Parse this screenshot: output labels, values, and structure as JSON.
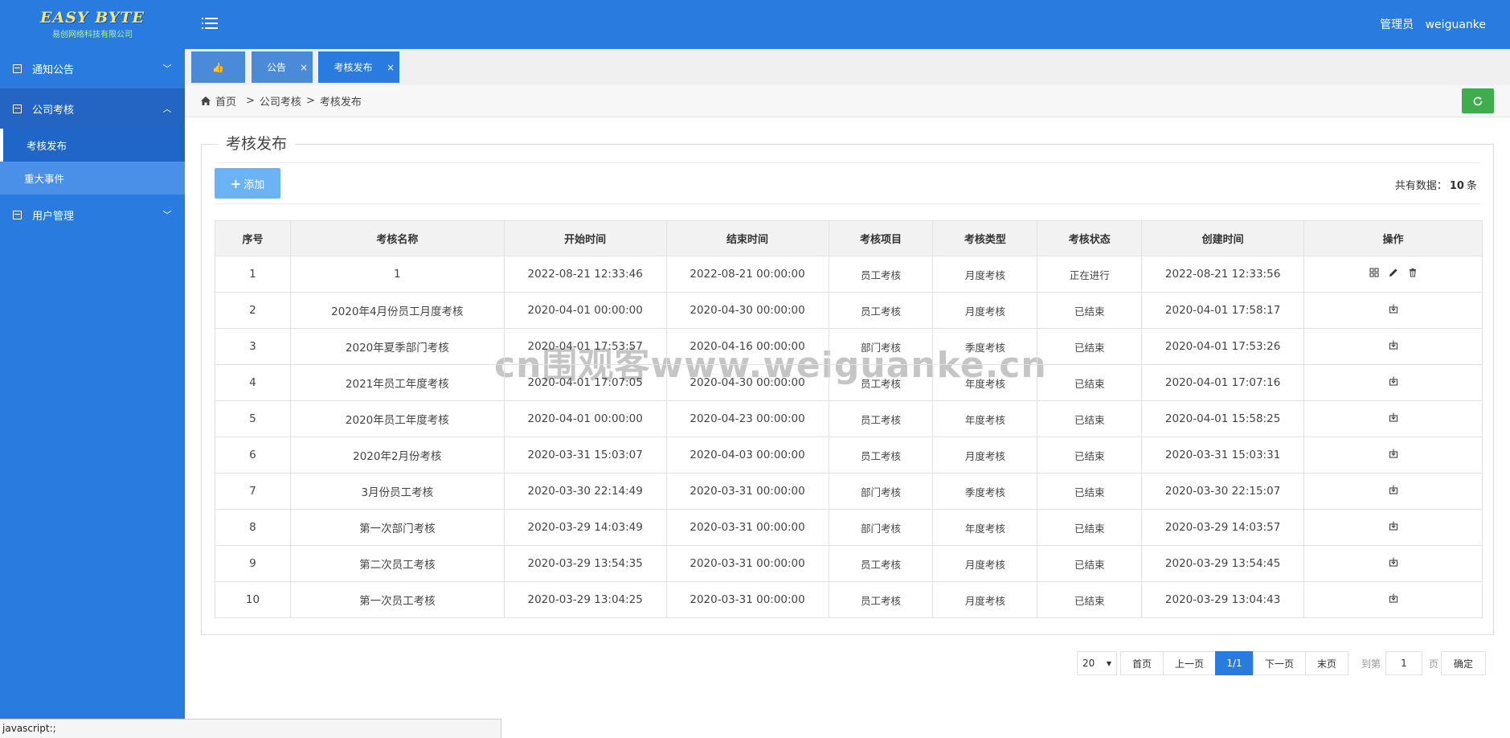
{
  "logo": {
    "main": "EASY BYTE",
    "sub": "易创网络科技有限公司"
  },
  "sidebar": {
    "groups": [
      {
        "label": "通知公告",
        "chevron": "﹀",
        "open": false
      },
      {
        "label": "公司考核",
        "chevron": "︿",
        "open": true,
        "items": [
          {
            "label": "考核发布",
            "active": true
          },
          {
            "label": "重大事件",
            "active": false
          }
        ]
      },
      {
        "label": "用户管理",
        "chevron": "﹀",
        "open": false
      }
    ]
  },
  "header": {
    "role": "管理员",
    "username": "weiguanke"
  },
  "tabs": [
    {
      "label": "👍",
      "closable": false
    },
    {
      "label": "公告",
      "closable": true
    },
    {
      "label": "考核发布",
      "closable": true,
      "active": true
    }
  ],
  "tab_close": "×",
  "breadcrumb": {
    "home": "首页",
    "sep": ">",
    "items": [
      "公司考核",
      "考核发布"
    ]
  },
  "panel": {
    "title": "考核发布",
    "add_label": "添加",
    "total_prefix": "共有数据：",
    "total_count": "10",
    "total_suffix": "条"
  },
  "table": {
    "headers": [
      "序号",
      "考核名称",
      "开始时间",
      "结束时间",
      "考核项目",
      "考核类型",
      "考核状态",
      "创建时间",
      "操作"
    ],
    "rows": [
      [
        "1",
        "1",
        "2022-08-21 12:33:46",
        "2022-08-21 00:00:00",
        "员工考核",
        "月度考核",
        "正在进行",
        "2022-08-21 12:33:56"
      ],
      [
        "2",
        "2020年4月份员工月度考核",
        "2020-04-01 00:00:00",
        "2020-04-30 00:00:00",
        "员工考核",
        "月度考核",
        "已结束",
        "2020-04-01 17:58:17"
      ],
      [
        "3",
        "2020年夏季部门考核",
        "2020-04-01 17:53:57",
        "2020-04-16 00:00:00",
        "部门考核",
        "季度考核",
        "已结束",
        "2020-04-01 17:53:26"
      ],
      [
        "4",
        "2021年员工年度考核",
        "2020-04-01 17:07:05",
        "2020-04-30 00:00:00",
        "员工考核",
        "年度考核",
        "已结束",
        "2020-04-01 17:07:16"
      ],
      [
        "5",
        "2020年员工年度考核",
        "2020-04-01 00:00:00",
        "2020-04-23 00:00:00",
        "员工考核",
        "年度考核",
        "已结束",
        "2020-04-01 15:58:25"
      ],
      [
        "6",
        "2020年2月份考核",
        "2020-03-31 15:03:07",
        "2020-04-03 00:00:00",
        "员工考核",
        "月度考核",
        "已结束",
        "2020-03-31 15:03:31"
      ],
      [
        "7",
        "3月份员工考核",
        "2020-03-30 22:14:49",
        "2020-03-31 00:00:00",
        "部门考核",
        "季度考核",
        "已结束",
        "2020-03-30 22:15:07"
      ],
      [
        "8",
        "第一次部门考核",
        "2020-03-29 14:03:49",
        "2020-03-31 00:00:00",
        "部门考核",
        "年度考核",
        "已结束",
        "2020-03-29 14:03:57"
      ],
      [
        "9",
        "第二次员工考核",
        "2020-03-29 13:54:35",
        "2020-03-31 00:00:00",
        "员工考核",
        "月度考核",
        "已结束",
        "2020-03-29 13:54:45"
      ],
      [
        "10",
        "第一次员工考核",
        "2020-03-29 13:04:25",
        "2020-03-31 00:00:00",
        "员工考核",
        "月度考核",
        "已结束",
        "2020-03-29 13:04:43"
      ]
    ],
    "row_ops": [
      [
        "grid-icon",
        "edit-icon",
        "delete-icon"
      ],
      [
        "export-icon"
      ],
      [
        "export-icon"
      ],
      [
        "export-icon"
      ],
      [
        "export-icon"
      ],
      [
        "export-icon"
      ],
      [
        "export-icon"
      ],
      [
        "export-icon"
      ],
      [
        "export-icon"
      ],
      [
        "export-icon"
      ]
    ]
  },
  "pager": {
    "page_size": "20",
    "first": "首页",
    "prev": "上一页",
    "current": "1/1",
    "next": "下一页",
    "last": "末页",
    "goto_label": "到第",
    "goto_value": "1",
    "page_label": "页",
    "confirm": "确定"
  },
  "statusbar": "javascript:;",
  "watermark": "cn围观客www.weiguanke.cn",
  "colors": {
    "primary": "#2a7be0",
    "refresh": "#3fad4e",
    "add": "#6cb3f5"
  }
}
